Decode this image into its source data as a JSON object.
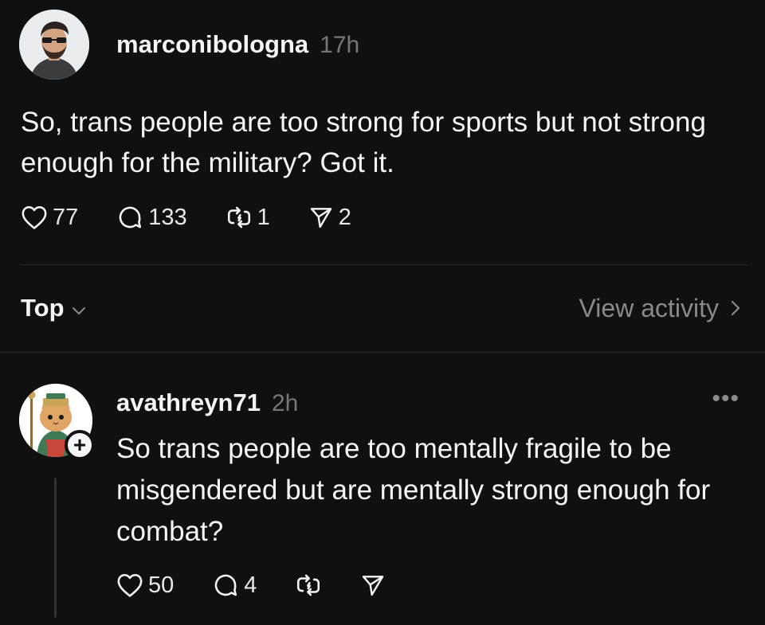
{
  "post": {
    "username": "marconibologna",
    "time": "17h",
    "text": "So, trans people are too strong for sports but not strong enough for the military? Got it.",
    "likes": "77",
    "comments": "133",
    "reposts": "1",
    "shares": "2"
  },
  "sort": {
    "label": "Top",
    "view_activity": "View activity"
  },
  "reply": {
    "username": "avathreyn71",
    "time": "2h",
    "more": "•••",
    "follow": "+",
    "text": "So trans people are too mentally fragile to be misgendered but are mentally strong enough for combat?",
    "likes": "50",
    "comments": "4"
  },
  "icons": {
    "like": "heart-icon",
    "comment": "comment-bubble-icon",
    "repost": "repost-icon",
    "share": "send-icon",
    "chevron_down": "chevron-down-icon",
    "chevron_right": "chevron-right-icon"
  },
  "colors": {
    "background": "#101010",
    "text": "#f3f5f7",
    "muted": "#777777",
    "divider": "#2a2a2a"
  }
}
